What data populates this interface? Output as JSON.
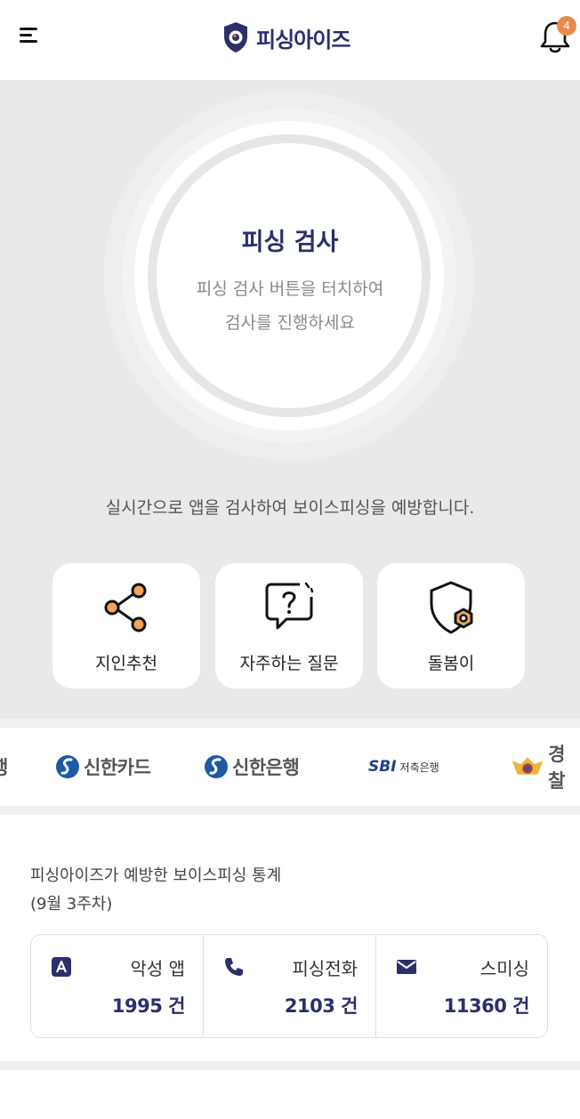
{
  "header": {
    "brand_name": "피싱아이즈",
    "notification_count": "4"
  },
  "hero": {
    "scan_title": "피싱 검사",
    "scan_desc_line1": "피싱 검사 버튼을 터치하여",
    "scan_desc_line2": "검사를 진행하세요",
    "tagline": "실시간으로 앱을 검사하여 보이스피싱을 예방합니다."
  },
  "cards": [
    {
      "label": "지인추천",
      "icon": "share-icon"
    },
    {
      "label": "자주하는 질문",
      "icon": "question-chat-icon"
    },
    {
      "label": "돌봄이",
      "icon": "shield-gear-icon"
    }
  ],
  "partners": [
    {
      "name": "행"
    },
    {
      "name": "신한카드"
    },
    {
      "name": "신한은행"
    },
    {
      "name": "SBI",
      "sub": "저축은행"
    },
    {
      "name": "경찰"
    }
  ],
  "stats": {
    "title": "피싱아이즈가 예방한 보이스피싱 통계",
    "week": "(9월 3주차)",
    "items": [
      {
        "label": "악성 앱",
        "value": "1995 건",
        "icon": "app-icon"
      },
      {
        "label": "피싱전화",
        "value": "2103 건",
        "icon": "phone-icon"
      },
      {
        "label": "스미싱",
        "value": "11360 건",
        "icon": "mail-icon"
      }
    ]
  },
  "colors": {
    "brand": "#2c2f6b",
    "accent": "#e98a4d",
    "hero_bg": "#e9e9e9"
  }
}
